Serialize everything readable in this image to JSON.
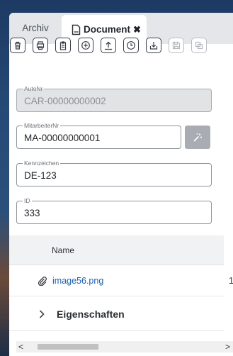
{
  "tabs": [
    {
      "label": "Archiv",
      "active": false
    },
    {
      "label": "Document",
      "active": true,
      "close": "✖"
    }
  ],
  "toolbar": {
    "buttons": [
      {
        "icon": "trash-icon",
        "enabled": true
      },
      {
        "icon": "print-icon",
        "enabled": true
      },
      {
        "icon": "clipboard-icon",
        "enabled": true
      },
      {
        "icon": "add-circle-icon",
        "enabled": true
      },
      {
        "icon": "upload-icon",
        "enabled": true
      },
      {
        "icon": "clock-icon",
        "enabled": true
      },
      {
        "icon": "download-icon",
        "enabled": true
      },
      {
        "icon": "save-icon",
        "enabled": false
      },
      {
        "icon": "copy-icon",
        "enabled": false
      }
    ]
  },
  "fields": {
    "autonr": {
      "label": "AutoNr",
      "value": "CAR-00000000002"
    },
    "mitarbeiternr": {
      "label": "MitarbeiterNr",
      "value": "MA-00000000001"
    },
    "kennzeichen": {
      "label": "Kennzeichen",
      "value": "DE-123"
    },
    "id": {
      "label": "ID",
      "value": "333"
    }
  },
  "files": {
    "column_name": "Name",
    "rows": [
      {
        "name": "image56.png",
        "extra": "1"
      }
    ]
  },
  "section": {
    "label": "Eigenschaften"
  },
  "scrollbar": {
    "left": "<",
    "right": ">"
  }
}
